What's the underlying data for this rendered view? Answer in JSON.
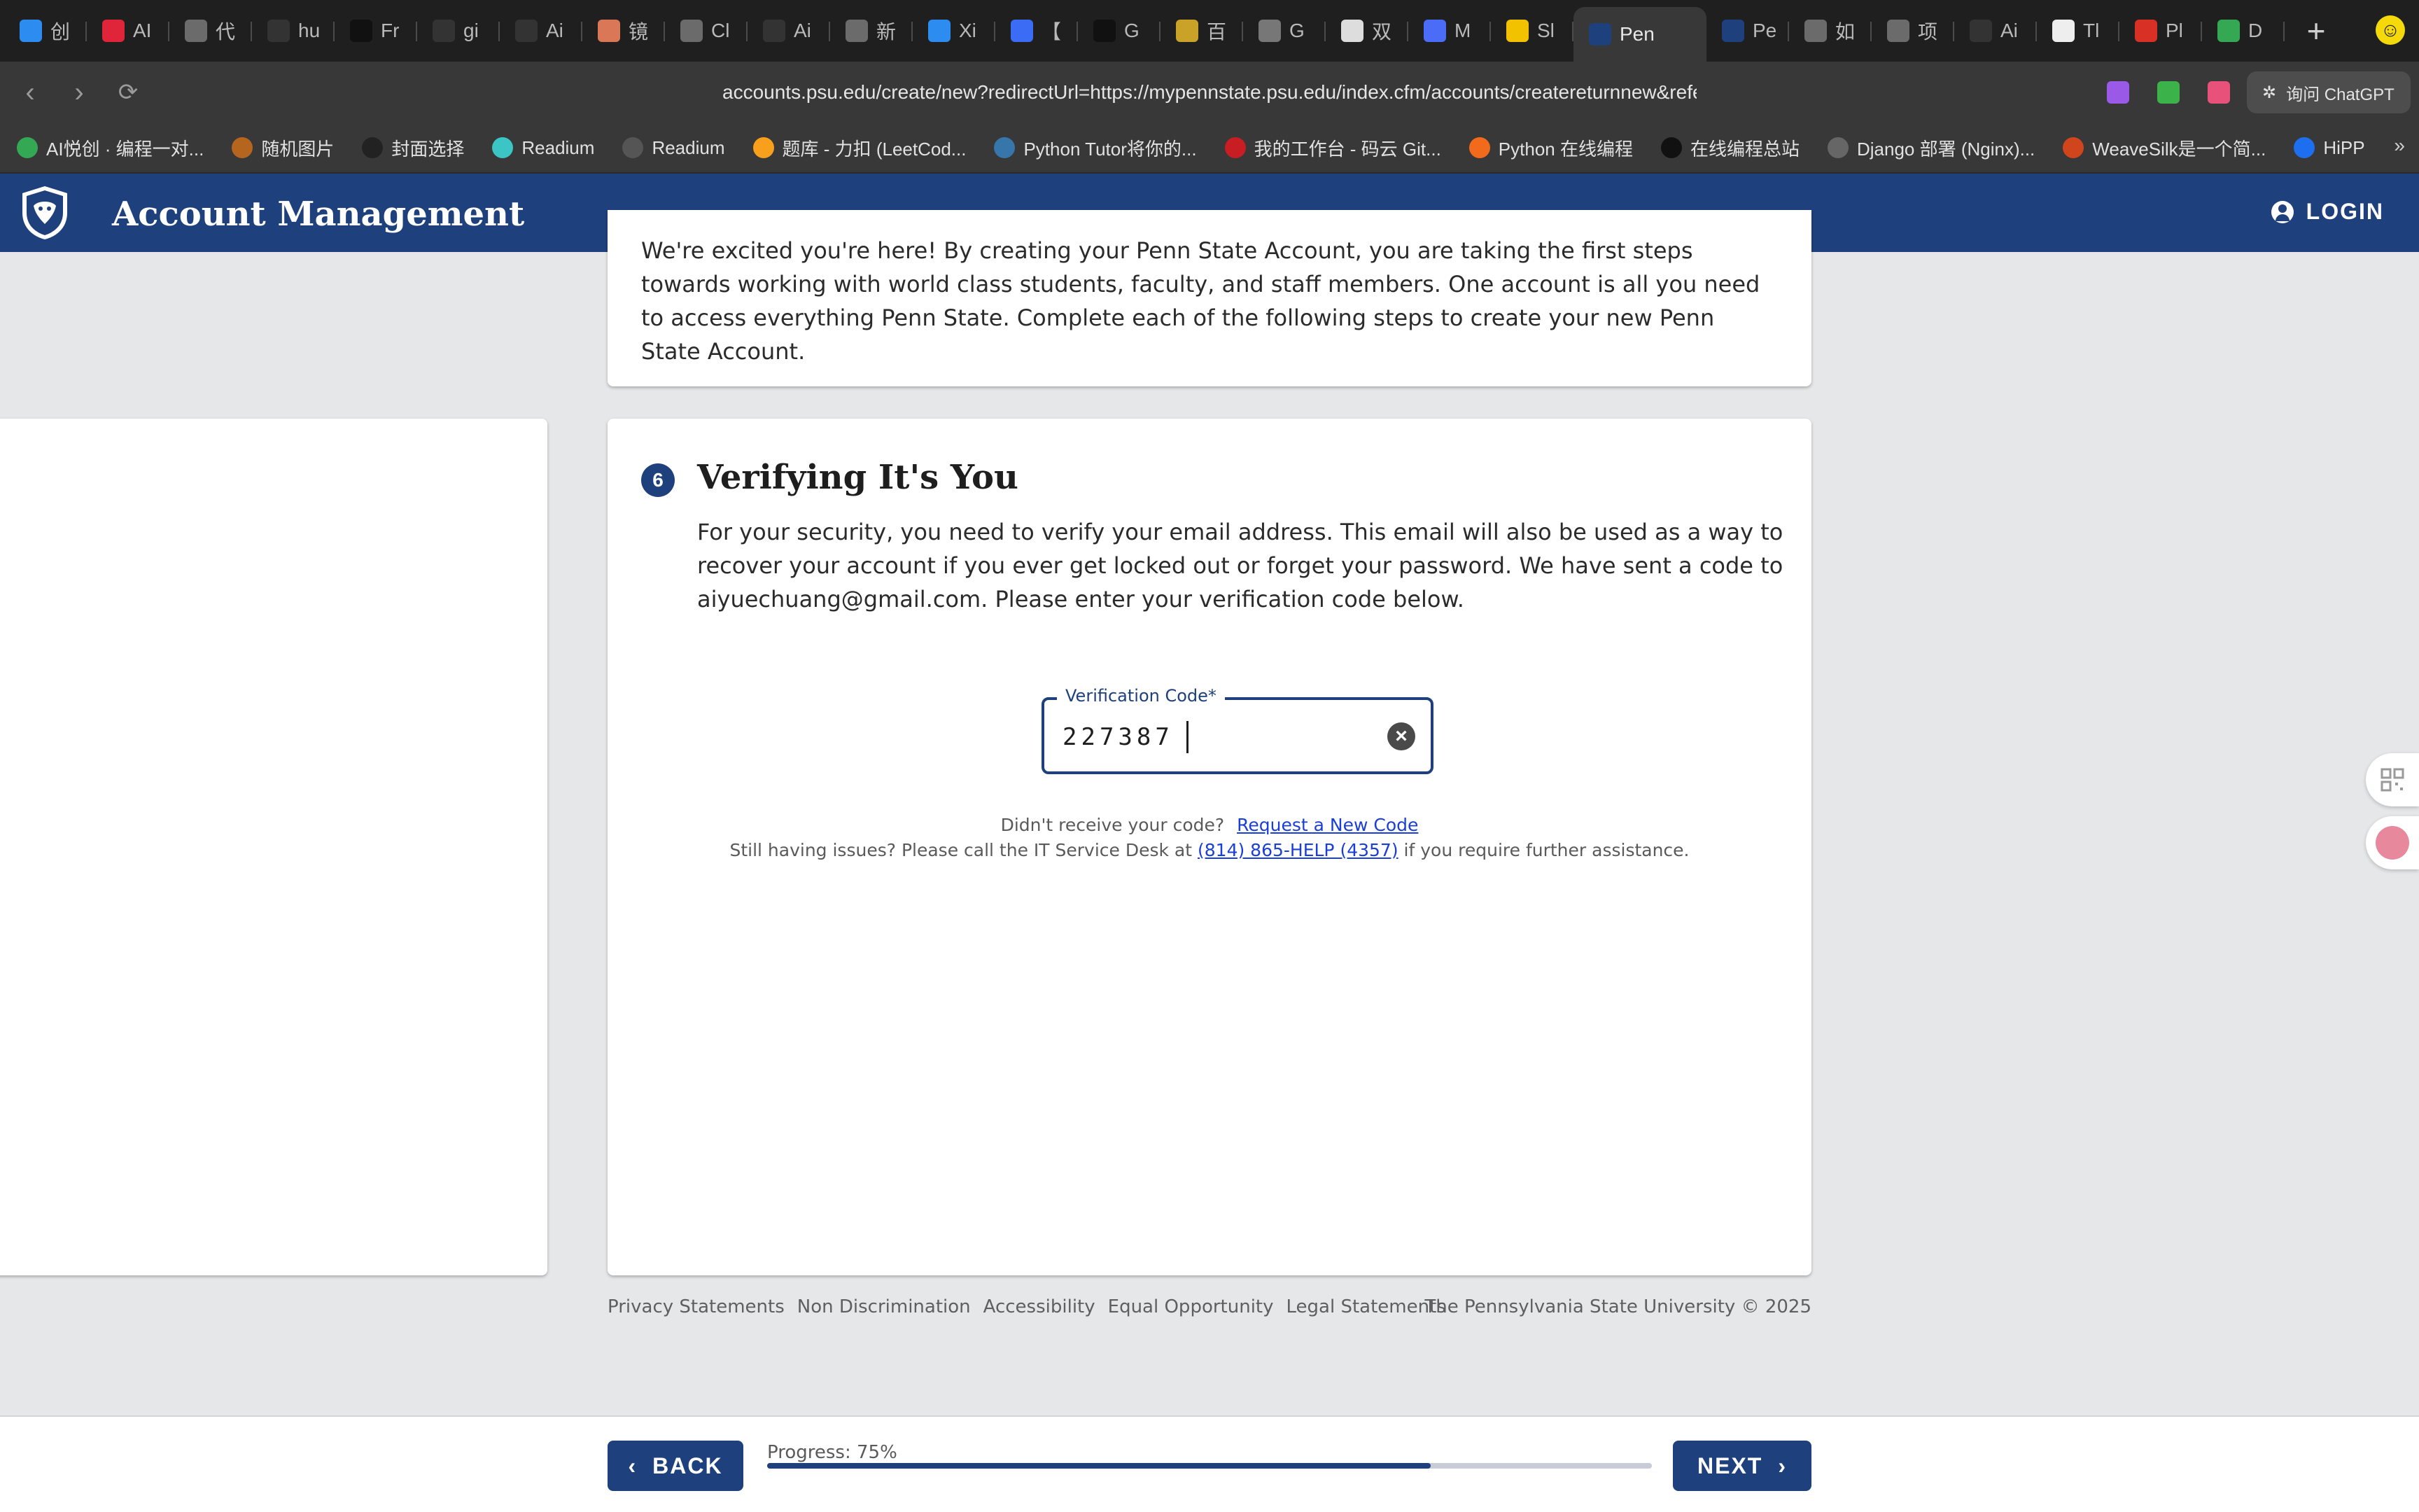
{
  "browser": {
    "tabs": [
      {
        "icon": "calendar-icon",
        "title": "创",
        "color": "#2d8cf0"
      },
      {
        "icon": "ai-icon",
        "title": "AI",
        "color": "#e0243a"
      },
      {
        "icon": "chatgpt-icon",
        "title": "代",
        "color": "#6b6b6b"
      },
      {
        "icon": "github-icon",
        "title": "hu",
        "color": "#333333"
      },
      {
        "icon": "smile-icon",
        "title": "Fr",
        "color": "#111111"
      },
      {
        "icon": "github-icon",
        "title": "gi",
        "color": "#333333"
      },
      {
        "icon": "github-icon",
        "title": "Ai",
        "color": "#333333"
      },
      {
        "icon": "claude-icon",
        "title": "镜",
        "color": "#d97757"
      },
      {
        "icon": "chatgpt-icon",
        "title": "Cl",
        "color": "#6b6b6b"
      },
      {
        "icon": "github-icon",
        "title": "Ai",
        "color": "#333333"
      },
      {
        "icon": "chatgpt-icon",
        "title": "新",
        "color": "#6b6b6b"
      },
      {
        "icon": "calendar-icon",
        "title": "Xi",
        "color": "#2d8cf0"
      },
      {
        "icon": "doc-icon",
        "title": "【",
        "color": "#3b6cf6"
      },
      {
        "icon": "cursor-icon",
        "title": "G",
        "color": "#111111"
      },
      {
        "icon": "image-icon",
        "title": "百",
        "color": "#c9a227"
      },
      {
        "icon": "compass-icon",
        "title": "G",
        "color": "#777777"
      },
      {
        "icon": "refresh-icon",
        "title": "双",
        "color": "#dddddd"
      },
      {
        "icon": "m-icon",
        "title": "M",
        "color": "#4a6cf7"
      },
      {
        "icon": "sl-icon",
        "title": "Sl",
        "color": "#f2c200"
      },
      {
        "icon": "psu-shield-icon",
        "title": "Pen",
        "color": "#1e407c"
      },
      {
        "icon": "psu-shield-icon",
        "title": "Pe",
        "color": "#1e407c"
      },
      {
        "icon": "chatgpt-icon",
        "title": "如",
        "color": "#6b6b6b"
      },
      {
        "icon": "chatgpt-icon",
        "title": "项",
        "color": "#6b6b6b"
      },
      {
        "icon": "github-icon",
        "title": "Ai",
        "color": "#333333"
      },
      {
        "icon": "ti-icon",
        "title": "Tl",
        "color": "#eeeeee"
      },
      {
        "icon": "gmail-icon",
        "title": "Pl",
        "color": "#d93025"
      },
      {
        "icon": "chrome-icon",
        "title": "D",
        "color": "#34a853"
      }
    ],
    "active_tab_index": 19,
    "new_tab_label": "+",
    "url": "accounts.psu.edu/create/new?redirectUrl=https://mypennstate.psu.edu/index.cfm/accounts/createreturnnew&refe",
    "ask_chatgpt_label": "询问 ChatGPT",
    "bookmarks": [
      {
        "label": "AI悦创 · 编程一对...",
        "color": "#34a853"
      },
      {
        "label": "随机图片",
        "color": "#b5651d"
      },
      {
        "label": "封面选择",
        "color": "#222222"
      },
      {
        "label": "Readium",
        "color": "#3cc5c5"
      },
      {
        "label": "Readium",
        "color": "#555555"
      },
      {
        "label": "题库 - 力扣 (LeetCod...",
        "color": "#f89f1b"
      },
      {
        "label": "Python Tutor将你的...",
        "color": "#3776ab"
      },
      {
        "label": "我的工作台 - 码云 Git...",
        "color": "#c71d23"
      },
      {
        "label": "Python 在线编程",
        "color": "#f26b1d"
      },
      {
        "label": "在线编程总站",
        "color": "#111111"
      },
      {
        "label": "Django 部署 (Nginx)...",
        "color": "#666666"
      },
      {
        "label": "WeaveSilk是一个简...",
        "color": "#d0451b"
      },
      {
        "label": "HiPP",
        "color": "#1e6ff0"
      }
    ],
    "bookmarks_more": "»"
  },
  "site": {
    "title": "Account Management",
    "login_label": "LOGIN",
    "brand_color": "#1e407c"
  },
  "intro": {
    "text": "We're excited you're here! By creating your Penn State Account, you are taking the first steps towards working with world class students, faculty, and staff members. One account is all you need to access everything Penn State. Complete each of the following steps to create your new Penn State Account."
  },
  "step": {
    "number": "6",
    "title": "Verifying It's You",
    "description": "For your security, you need to verify your email address. This email will also be used as a way to recover your account if you ever get locked out or forget your password. We have sent a code to aiyuechuang@gmail.com. Please enter your verification code below.",
    "field_label": "Verification Code*",
    "field_value": "227387",
    "clear_icon": "clear-circle-icon",
    "resend_prompt": "Didn't receive your code?",
    "resend_link": "Request a New Code",
    "help_prefix": "Still having issues? Please call the IT Service Desk at",
    "help_phone": "(814) 865-HELP (4357)",
    "help_suffix": "if you require further assistance."
  },
  "footer": {
    "links": [
      "Privacy Statements",
      "Non Discrimination",
      "Accessibility",
      "Equal Opportunity",
      "Legal Statements"
    ],
    "copyright": "The Pennsylvania State University © 2025"
  },
  "navigation": {
    "back_label": "BACK",
    "next_label": "NEXT",
    "progress_label": "Progress: 75%",
    "progress_fraction": 0.75
  }
}
